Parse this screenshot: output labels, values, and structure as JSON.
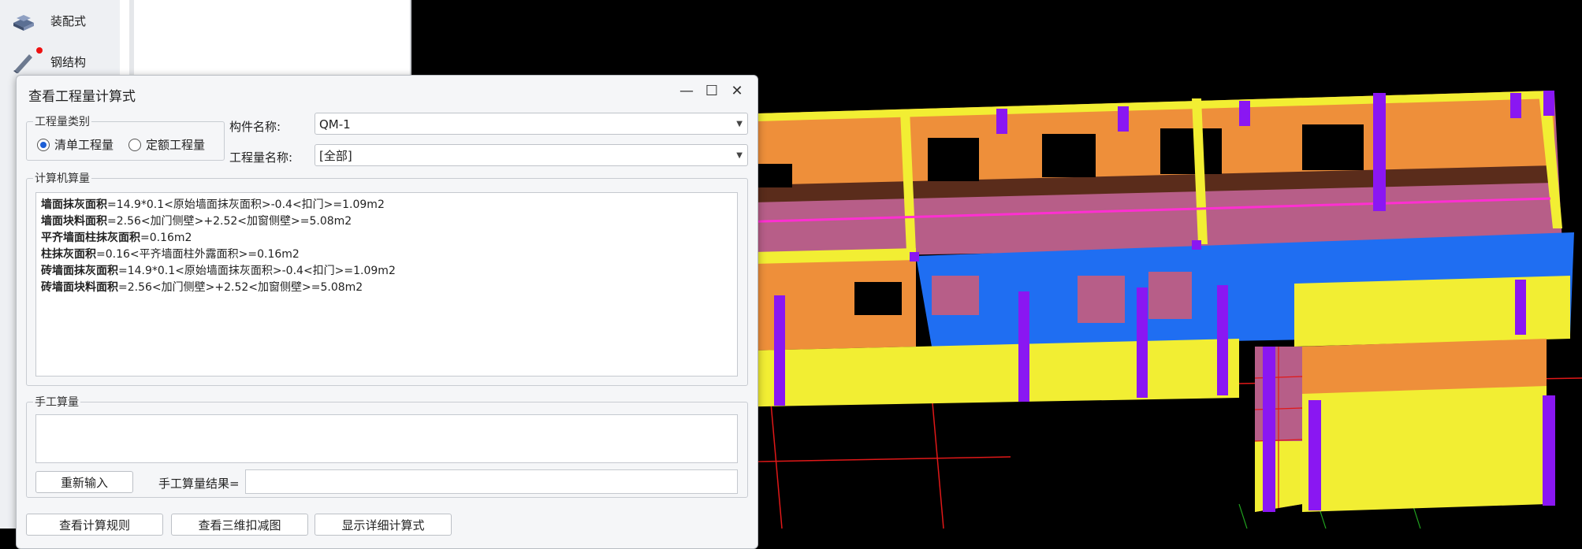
{
  "sidebar": {
    "items": [
      {
        "label": "装配式",
        "icon": "prefab-icon"
      },
      {
        "label": "钢结构",
        "icon": "steel-structure-icon"
      }
    ]
  },
  "dialog": {
    "title": "查看工程量计算式",
    "category_group": {
      "legend": "工程量类别",
      "options": [
        {
          "label": "清单工程量",
          "selected": true
        },
        {
          "label": "定额工程量",
          "selected": false
        }
      ]
    },
    "component_name_label": "构件名称:",
    "component_name_value": "QM-1",
    "quantity_name_label": "工程量名称:",
    "quantity_name_value": "[全部]",
    "computer_group_legend": "计算机算量",
    "formulas": [
      {
        "name": "墙面抹灰面积",
        "expr": "=14.9*0.1<原始墙面抹灰面积>-0.4<扣门>=1.09m2"
      },
      {
        "name": "墙面块料面积",
        "expr": "=2.56<加门侧壁>+2.52<加窗侧壁>=5.08m2"
      },
      {
        "name": "平齐墙面柱抹灰面积",
        "expr": "=0.16m2"
      },
      {
        "name": "柱抹灰面积",
        "expr": "=0.16<平齐墙面柱外露面积>=0.16m2"
      },
      {
        "name": "砖墙面抹灰面积",
        "expr": "=14.9*0.1<原始墙面抹灰面积>-0.4<扣门>=1.09m2"
      },
      {
        "name": "砖墙面块料面积",
        "expr": "=2.56<加门侧壁>+2.52<加窗侧壁>=5.08m2"
      }
    ],
    "manual_group_legend": "手工算量",
    "reenter_button": "重新输入",
    "manual_result_label": "手工算量结果=",
    "bottom_buttons": [
      "查看计算规则",
      "查看三维扣减图",
      "显示详细计算式"
    ]
  },
  "colors": {
    "wall_yellow": "#f2ee33",
    "wall_orange": "#ee8f3a",
    "floor_pink": "#b75e88",
    "column_purple": "#8a17f2",
    "slab_blue": "#1f6ef2",
    "grid_red": "#e01818",
    "background": "#000000"
  }
}
